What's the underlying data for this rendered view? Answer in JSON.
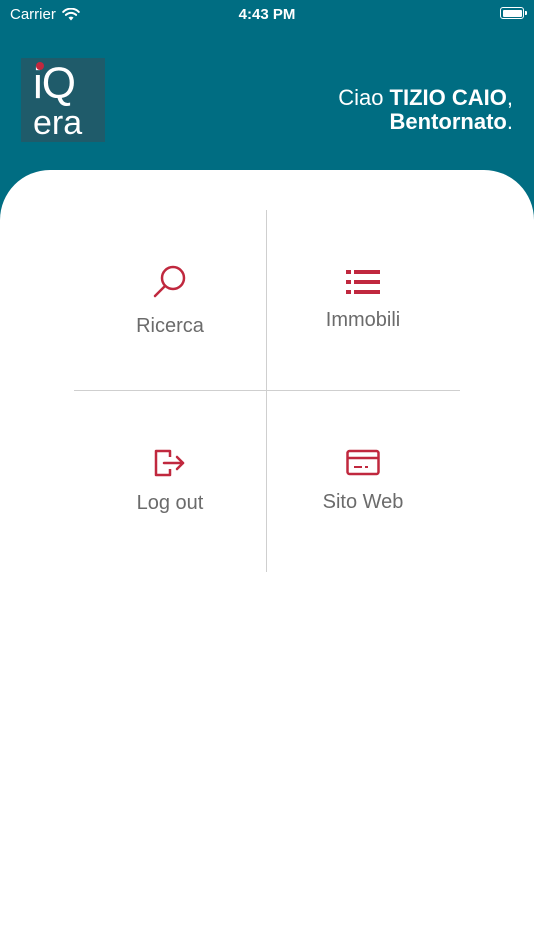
{
  "status_bar": {
    "carrier": "Carrier",
    "time": "4:43 PM"
  },
  "header": {
    "logo": {
      "top_text": "iQ",
      "bottom_text": "era"
    },
    "greeting_prefix": "Ciao ",
    "user_name": "TIZIO CAIO",
    "greeting_suffix": ",",
    "welcome": "Bentornato",
    "welcome_suffix": "."
  },
  "menu": {
    "items": [
      {
        "label": "Ricerca",
        "icon": "search-icon"
      },
      {
        "label": "Immobili",
        "icon": "list-icon"
      },
      {
        "label": "Log out",
        "icon": "logout-icon"
      },
      {
        "label": "Sito Web",
        "icon": "credit-card-icon"
      }
    ]
  },
  "colors": {
    "header_bg": "#006d82",
    "accent": "#c0283e",
    "label": "#6b6b6b",
    "divider": "#cfcfcf"
  }
}
